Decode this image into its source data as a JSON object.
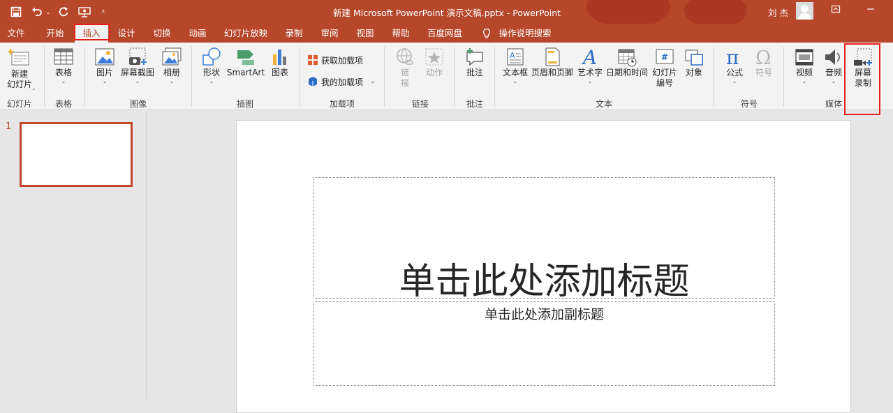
{
  "window": {
    "title": "新建 Microsoft PowerPoint 演示文稿.pptx  -  PowerPoint",
    "user_name": "刘 杰",
    "restore_icon": "ribbon-display-icon",
    "minimize_icon": "minimize-icon"
  },
  "quick_access": [
    "save-icon",
    "undo-icon",
    "redo-icon",
    "present-from-start-icon",
    "customize-icon"
  ],
  "menu": {
    "tabs": [
      "文件",
      "开始",
      "插入",
      "设计",
      "切换",
      "动画",
      "幻灯片放映",
      "录制",
      "审阅",
      "视图",
      "帮助",
      "百度网盘"
    ],
    "active_tab": "插入",
    "tell_me": "操作说明搜索"
  },
  "ribbon": {
    "new_slide": {
      "line1": "新建",
      "line2": "幻灯片"
    },
    "table": "表格",
    "picture": "图片",
    "screenshot": "屏幕截图",
    "album": "相册",
    "shapes": "形状",
    "smartart": "SmartArt",
    "chart": "图表",
    "get_addins": "获取加载项",
    "my_addins": "我的加载项",
    "link": {
      "line1": "链",
      "line2": "接"
    },
    "action": "动作",
    "comment": "批注",
    "textbox": "文本框",
    "header_footer": "页眉和页脚",
    "wordart": "艺术字",
    "datetime": "日期和时间",
    "slide_number": {
      "line1": "幻灯片",
      "line2": "编号"
    },
    "object": "对象",
    "equation": "公式",
    "symbol": "符号",
    "video": "视频",
    "audio": "音频",
    "screen_recording": {
      "line1": "屏幕",
      "line2": "录制"
    },
    "groups": {
      "slides": "幻灯片",
      "tables": "表格",
      "images": "图像",
      "illustrations": "插图",
      "addins": "加载项",
      "links": "链接",
      "comments": "批注",
      "text": "文本",
      "symbols": "符号",
      "media": "媒体"
    }
  },
  "thumbnails": [
    {
      "number": "1"
    }
  ],
  "slide": {
    "title_placeholder": "单击此处添加标题",
    "subtitle_placeholder": "单击此处添加副标题"
  },
  "colors": {
    "accent": "#b7472a",
    "highlight": "#e8201c"
  }
}
